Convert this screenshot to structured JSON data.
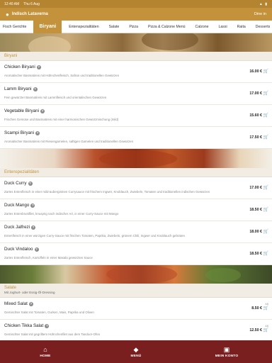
{
  "status": {
    "time": "12:40 AM",
    "date": "Thu 6 Aug"
  },
  "header": {
    "shop_name": "Indisch Lataverna",
    "mode": "Dine in"
  },
  "tabs": [
    "Fisch Gerichte",
    "Biryani",
    "Entenspezialitäten",
    "Salate",
    "Pizza",
    "Pizza & Calzone Menü",
    "Calzone",
    "Lassi",
    "Raita",
    "Desserts"
  ],
  "active_tab": "Biryani",
  "sections": {
    "biryani": {
      "title": "Biryani",
      "items": [
        {
          "name": "Chicken Biryani",
          "desc": "Aromatischer Basmatireis mit Hühnchenfleisch, Safran und traditionellen Gewürzen",
          "price": "16.00 €"
        },
        {
          "name": "Lamm Biryani",
          "desc": "Fein gewürzter Basmatireis mit Lammfleisch und orientalischen Gewürzen",
          "price": "17.00 €"
        },
        {
          "name": "Vegetable Biryani",
          "desc": "Frisches Gemüse und Basmatireis mit einer harmonischen Gewürzmischung (mild)",
          "price": "15.60 €"
        },
        {
          "name": "Scampi Biryani",
          "desc": "Aromatischer Basmatireis mit Riesengarnelen, saftigen Garnelen und traditionellen Gewürzen",
          "price": "17.50 €"
        }
      ]
    },
    "ente": {
      "title": "Entenspezialitäten",
      "items": [
        {
          "name": "Duck Curry",
          "desc": "Zartes Entenfleisch in einer mild-aubergininen Currysauce mit frischem Ingwer, Knoblauch, Zwiebeln, Tomaten und traditionellen indischen Gewürzen",
          "price": "17.00 €"
        },
        {
          "name": "Duck Mango",
          "desc": "Zartes Entenbrustfilet, knusprig nach indischer Art, in einer Curry-Sauce mit Mango",
          "price": "18.50 €"
        },
        {
          "name": "Duck Jalfrezi",
          "desc": "Entenfleisch in einer würzigen Curry-Sauce mit frischen Tomaten, Paprika, Zwiebeln, grünem Chili, Ingwer und Knoblauch gebraten",
          "price": "18.00 €"
        },
        {
          "name": "Duck Vindaloo",
          "desc": "Zartes Entenfleisch, Kartoffeln in einer Masala gewürzten Sauce",
          "price": "18.50 €"
        }
      ]
    },
    "salate": {
      "title": "Salate",
      "subtitle": "Mit Joghurt- oder Essig-Öl-Dressing",
      "items": [
        {
          "name": "Mixed Salat",
          "desc": "Gemischter Salat mit Tomaten, Gurken, Mais, Paprika und Oliven",
          "price": "8.50 €",
          "prefix": "AB"
        },
        {
          "name": "Chicken Tikka Salat",
          "desc": "Gemischter Salat mit gegrilltem Hühnchenfilet aus dem Tandoor-Ofen",
          "price": "12.50 €",
          "prefix": "AB"
        }
      ]
    }
  },
  "bottom_nav": [
    "HOME",
    "MENÜ",
    "MEIN KONTO"
  ],
  "colors": {
    "accent": "#c4923a",
    "nav_bg": "#7a1f1f",
    "section_bg": "#f1ede5"
  }
}
